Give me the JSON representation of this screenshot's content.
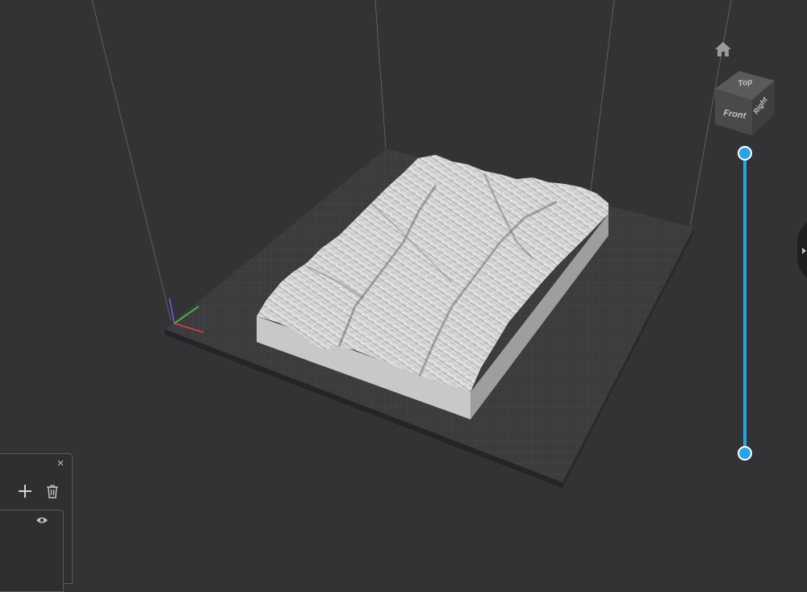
{
  "app": {
    "view_cube": {
      "top": "Top",
      "front": "Front",
      "right": "Right"
    },
    "layer_slider": {
      "upper_layer_fraction": 1.0,
      "lower_layer_fraction": 0.0,
      "color": "#26a5e4"
    },
    "objects_panel": {
      "close_glyph": "×"
    },
    "icons": {
      "home": "home-icon",
      "add": "plus-icon",
      "delete": "trash-icon",
      "visibility": "eye-icon",
      "collapse": "chevron-right-icon"
    },
    "colors": {
      "background": "#333335",
      "build_plate": "#3b3b3d",
      "model": "#d9d9d9",
      "accent": "#26a5e4"
    }
  }
}
